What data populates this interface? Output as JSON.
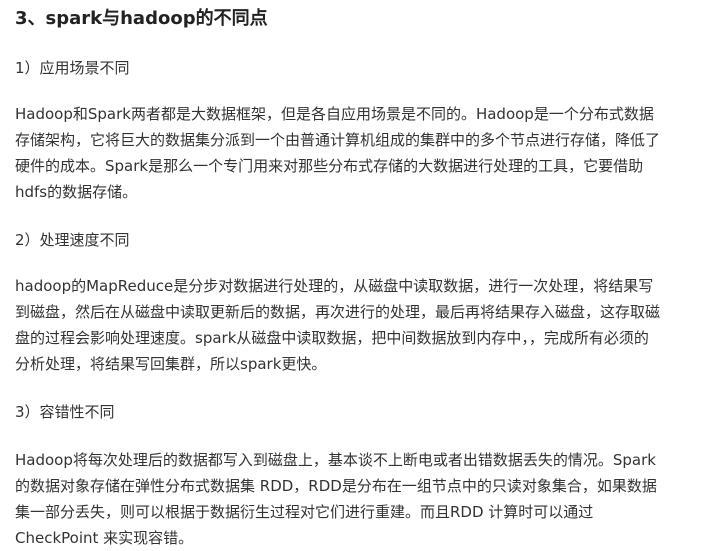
{
  "title": "3、spark与hadoop的不同点",
  "sections": [
    {
      "heading": "1）应用场景不同",
      "lines": [
        "Hadoop和Spark两者都是大数据框架，但是各自应用场景是不同的。Hadoop是一个分布式数据",
        "存储架构，它将巨大的数据集分派到一个由普通计算机组成的集群中的多个节点进行存储，降低了",
        "硬件的成本。Spark是那么一个专门用来对那些分布式存储的大数据进行处理的工具，它要借助",
        "hdfs的数据存储。"
      ]
    },
    {
      "heading": "2）处理速度不同",
      "lines": [
        "hadoop的MapReduce是分步对数据进行处理的，从磁盘中读取数据，进行一次处理，将结果写",
        "到磁盘，然后在从磁盘中读取更新后的数据，再次进行的处理，最后再将结果存入磁盘，这存取磁",
        "盘的过程会影响处理速度。spark从磁盘中读取数据，把中间数据放到内存中，，完成所有必须的",
        "分析处理，将结果写回集群，所以spark更快。"
      ]
    },
    {
      "heading": "3）容错性不同",
      "lines": [
        "Hadoop将每次处理后的数据都写入到磁盘上，基本谈不上断电或者出错数据丢失的情况。Spark",
        "的数据对象存储在弹性分布式数据集 RDD，RDD是分布在一组节点中的只读对象集合，如果数据",
        "集一部分丢失，则可以根据于数据衍生过程对它们进行重建。而且RDD 计算时可以通过",
        "CheckPoint 来实现容错。"
      ]
    }
  ]
}
